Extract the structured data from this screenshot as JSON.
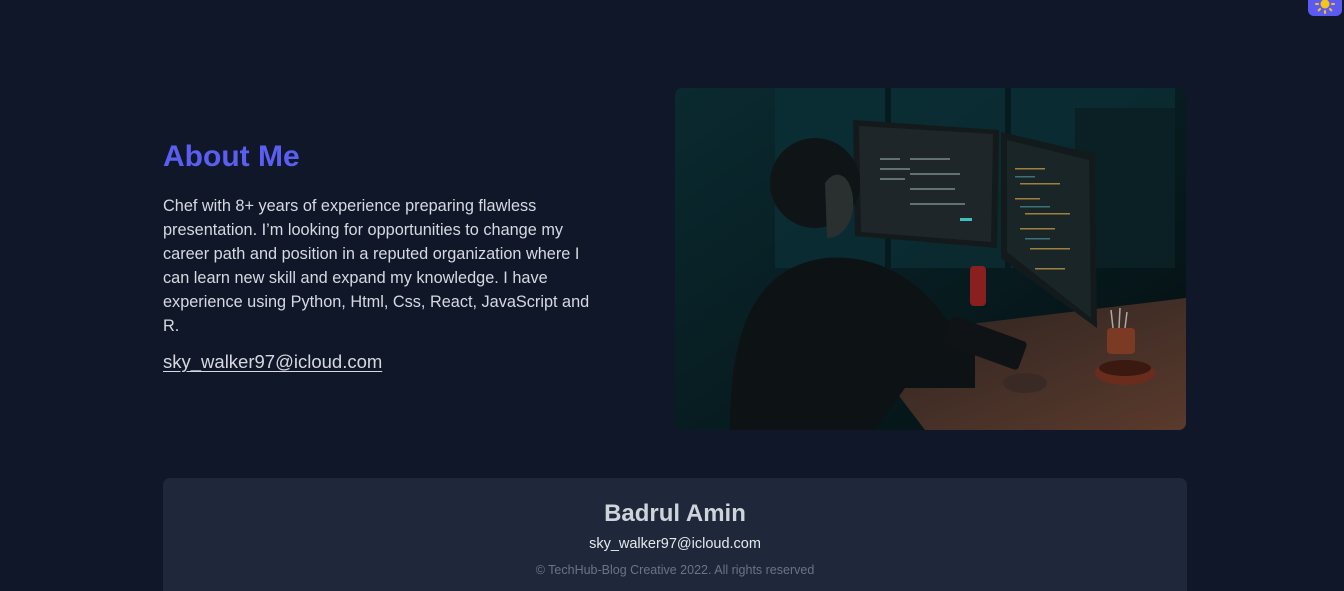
{
  "about": {
    "title": "About Me",
    "body": "Chef with 8+ years of experience preparing flawless presentation. I’m looking for opportunities to change my career path and position in a reputed organization where I can learn new skill and expand my knowledge. I have experience using Python, Html, Css, React, JavaScript and R.",
    "email": "sky_walker97@icloud.com",
    "image_icon": "developer-at-desk-photo"
  },
  "footer": {
    "name": "Badrul Amin",
    "email": "sky_walker97@icloud.com",
    "copyright": "© TechHub-Blog Creative 2022. All rights reserved"
  },
  "theme_toggle": {
    "icon": "sun-icon"
  },
  "colors": {
    "background": "#101729",
    "accent": "#5b5ff1",
    "footer_bg": "#1e283a",
    "text": "#d6d9e0",
    "muted": "#6b7385"
  }
}
